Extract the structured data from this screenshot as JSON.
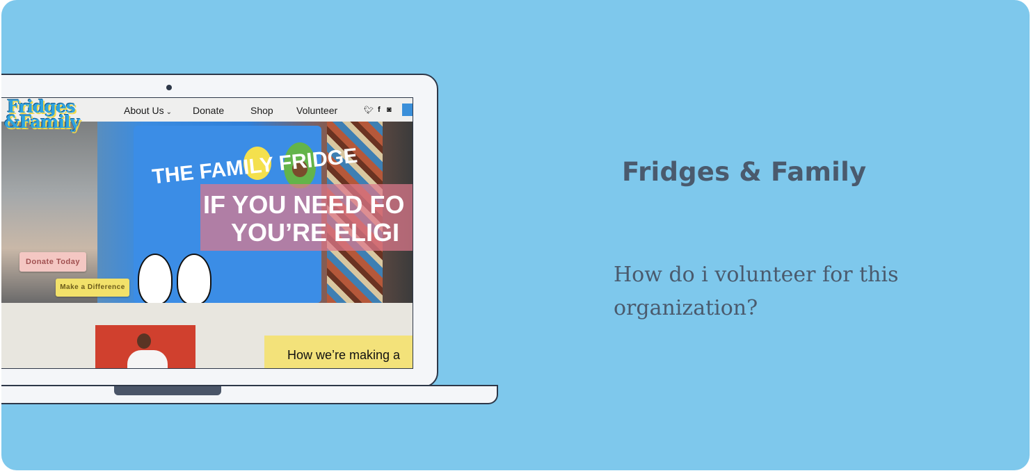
{
  "site": {
    "logo_line1": "Fridges",
    "logo_line2": "&Family",
    "nav": {
      "about": "About Us",
      "donate": "Donate",
      "shop": "Shop",
      "volunteer": "Volunteer"
    },
    "social_icons": [
      "twitter-icon",
      "facebook-icon",
      "instagram-icon"
    ],
    "hero": {
      "headline_line1": "IF YOU NEED FO",
      "headline_line2": "YOU’RE ELIGI",
      "donate_button": "Donate Today",
      "difference_button": "Make a Difference",
      "fridge_text": "THE FAMILY FRIDGE"
    },
    "impact_heading": "How we’re making a"
  },
  "panel": {
    "title": "Fridges & Family",
    "question": "How do i volunteer for this organization?"
  },
  "colors": {
    "background": "#7ec8ec",
    "text": "#4a5a6d",
    "logo": "#2ea3e0"
  }
}
